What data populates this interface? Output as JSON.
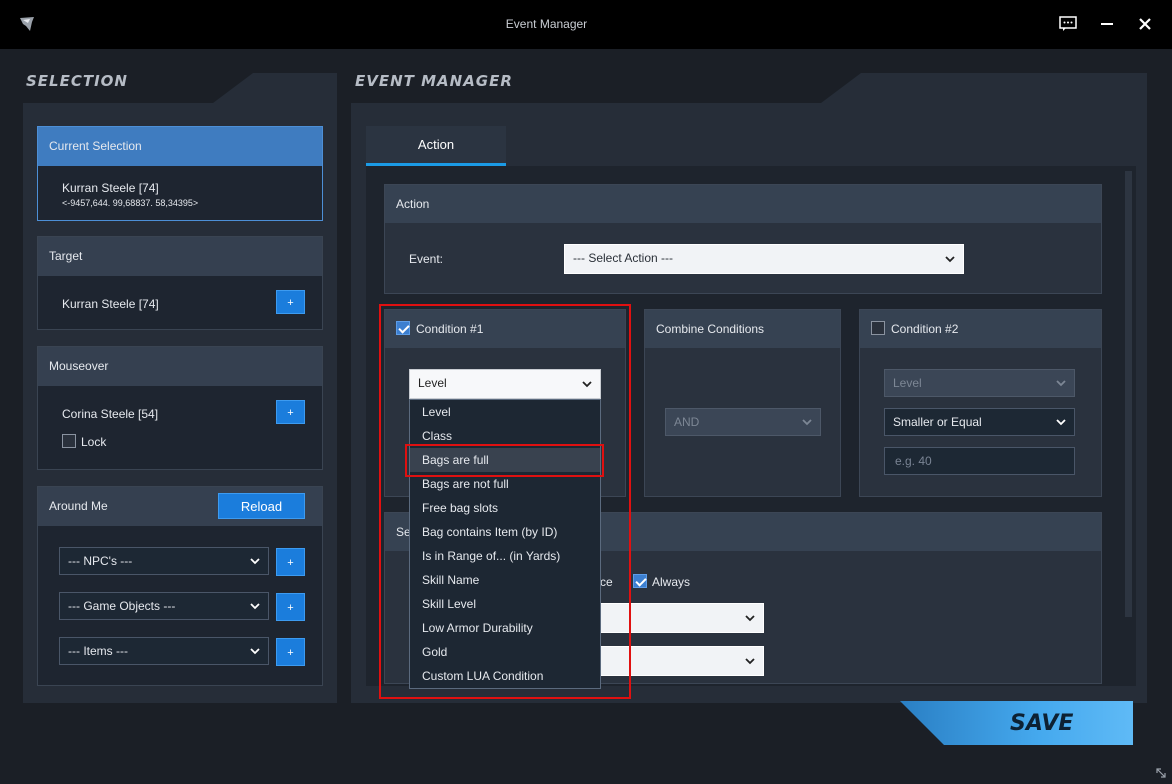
{
  "window": {
    "title": "Event Manager"
  },
  "selection": {
    "heading": "SELECTION",
    "current": {
      "label": "Current Selection",
      "name": "Kurran Steele [74]",
      "coords": "<-9457,644. 99,68837. 58,34395>"
    },
    "target": {
      "label": "Target",
      "name": "Kurran Steele [74]",
      "add": "+"
    },
    "mouseover": {
      "label": "Mouseover",
      "name": "Corina Steele [54]",
      "add": "+",
      "lock_label": "Lock"
    },
    "around": {
      "label": "Around Me",
      "reload": "Reload",
      "selects": [
        {
          "value": "--- NPC's ---",
          "add": "+"
        },
        {
          "value": "--- Game Objects ---",
          "add": "+"
        },
        {
          "value": "--- Items ---",
          "add": "+"
        }
      ]
    }
  },
  "event_manager": {
    "heading": "EVENT MANAGER",
    "tab": "Action",
    "action_panel": {
      "label": "Action",
      "event_label": "Event:",
      "event_value": "--- Select Action ---"
    },
    "condition1": {
      "label": "Condition #1",
      "checked": true,
      "value": "Level"
    },
    "combine": {
      "label": "Combine Conditions",
      "value": "AND"
    },
    "condition2": {
      "label": "Condition #2",
      "checked": false,
      "type_value": "Level",
      "operator_value": "Smaller or Equal",
      "input_placeholder": "e.g. 40"
    },
    "lower_panel": {
      "label_partial": "Se",
      "once_partial": "ce",
      "always_label": "Always",
      "always_checked": true
    },
    "dropdown_options": [
      "Level",
      "Class",
      "Bags are full",
      "Bags are not full",
      "Free bag slots",
      "Bag contains Item (by ID)",
      "Is in Range of... (in Yards)",
      "Skill Name",
      "Skill Level",
      "Low Armor Durability",
      "Gold",
      "Custom LUA Condition"
    ],
    "save": "SAVE"
  },
  "colors": {
    "accent": "#1b7ddc",
    "highlight_red": "#e01010",
    "active_header": "#3f7cc0"
  }
}
